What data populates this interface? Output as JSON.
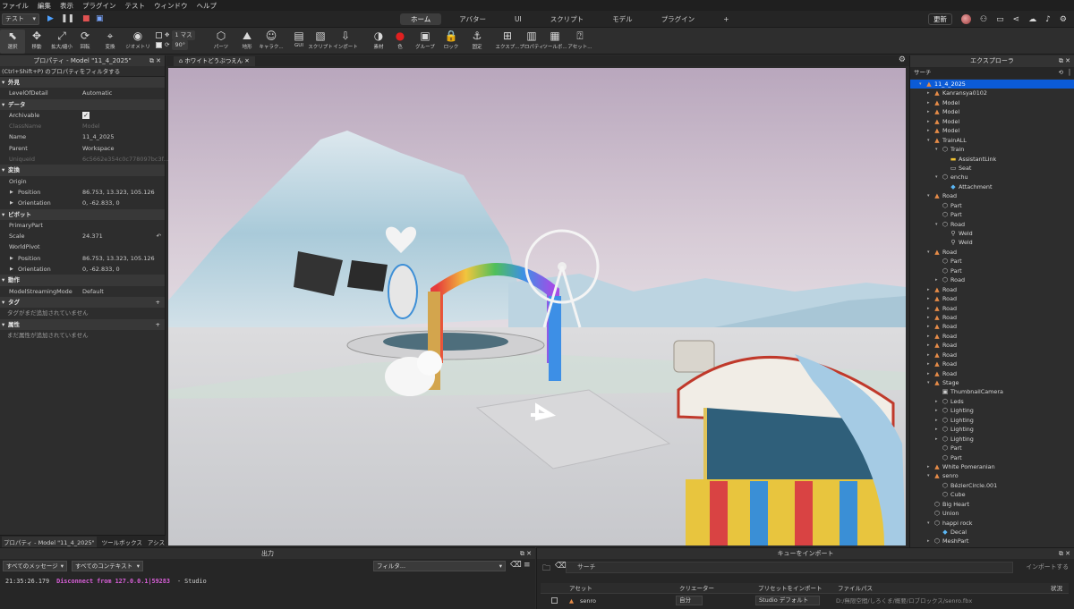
{
  "menu": [
    "ファイル",
    "編集",
    "表示",
    "プラグイン",
    "テスト",
    "ウィンドウ",
    "ヘルプ"
  ],
  "toolbar": {
    "mode_select": "テスト",
    "tabs": [
      "ホーム",
      "アバター",
      "UI",
      "スクリプト",
      "モデル",
      "プラグイン",
      "+"
    ],
    "active_tab": "ホーム",
    "update_label": "更新"
  },
  "ribbon": {
    "tools": [
      "選択",
      "移動",
      "拡大/縮小",
      "回転",
      "変換",
      "ジオメトリ",
      "パーツ",
      "地形",
      "キャラク...",
      "GUI",
      "スクリプト",
      "インポート",
      "素材",
      "色",
      "グループ",
      "ロック",
      "固定",
      "エクスプ...",
      "プロパティ",
      "ツールボ...",
      "アセット..."
    ],
    "grid_move": "1 マス",
    "grid_rotate": "90°"
  },
  "properties": {
    "title": "プロパティ - Model \"11_4_2025\"",
    "filter": "(Ctrl+Shift+P) のプロパティをフィルタする",
    "rows": [
      {
        "type": "section",
        "label": "外見"
      },
      {
        "type": "prop",
        "key": "LevelOfDetail",
        "value": "Automatic"
      },
      {
        "type": "section",
        "label": "データ"
      },
      {
        "type": "check",
        "key": "Archivable",
        "value": "✓"
      },
      {
        "type": "dim",
        "key": "ClassName",
        "value": "Model"
      },
      {
        "type": "prop",
        "key": "Name",
        "value": "11_4_2025"
      },
      {
        "type": "prop",
        "key": "Parent",
        "value": "Workspace"
      },
      {
        "type": "dim",
        "key": "UniqueId",
        "value": "6c5662e354c0c778097bc3f..."
      },
      {
        "type": "section",
        "label": "変換"
      },
      {
        "type": "prop",
        "key": "Origin",
        "value": ""
      },
      {
        "type": "sub",
        "key": "Position",
        "value": "86.753, 13.323, 105.126"
      },
      {
        "type": "sub",
        "key": "Orientation",
        "value": "0, -62.833, 0"
      },
      {
        "type": "section",
        "label": "ピボット"
      },
      {
        "type": "prop",
        "key": "PrimaryPart",
        "value": ""
      },
      {
        "type": "prop",
        "key": "Scale",
        "value": "24.371"
      },
      {
        "type": "prop",
        "key": "WorldPivot",
        "value": ""
      },
      {
        "type": "sub",
        "key": "Position",
        "value": "86.753, 13.323, 105.126"
      },
      {
        "type": "sub",
        "key": "Orientation",
        "value": "0, -62.833, 0"
      },
      {
        "type": "section",
        "label": "動作"
      },
      {
        "type": "prop",
        "key": "ModelStreamingMode",
        "value": "Default"
      },
      {
        "type": "section",
        "label": "タグ",
        "plus": "+"
      },
      {
        "type": "note",
        "key": "タグがまだ追加されていません"
      },
      {
        "type": "section",
        "label": "属性",
        "plus": "+"
      },
      {
        "type": "note",
        "key": "まだ属性が追加されていません"
      }
    ],
    "footer_tabs": [
      "プロパティ - Model \"11_4_2025\"",
      "ツールボックス",
      "アシス"
    ]
  },
  "viewport": {
    "doc_tab": "ホワイトどうぶつえん"
  },
  "explorer": {
    "title": "エクスプローラ",
    "search_placeholder": "サーチ",
    "items": [
      {
        "depth": 0,
        "arrow": "▾",
        "icon": "model",
        "label": "11_4_2025",
        "selected": true
      },
      {
        "depth": 1,
        "arrow": "▸",
        "icon": "model",
        "label": "Kanransya0102"
      },
      {
        "depth": 1,
        "arrow": "▸",
        "icon": "model",
        "label": "Model"
      },
      {
        "depth": 1,
        "arrow": "▸",
        "icon": "model",
        "label": "Model"
      },
      {
        "depth": 1,
        "arrow": "▸",
        "icon": "model",
        "label": "Model"
      },
      {
        "depth": 1,
        "arrow": "▸",
        "icon": "model",
        "label": "Model"
      },
      {
        "depth": 1,
        "arrow": "▾",
        "icon": "model",
        "label": "TrainALL"
      },
      {
        "depth": 2,
        "arrow": "▾",
        "icon": "part",
        "label": "Train"
      },
      {
        "depth": 3,
        "arrow": "",
        "icon": "folder",
        "label": "AssistantLink"
      },
      {
        "depth": 3,
        "arrow": "",
        "icon": "seat",
        "label": "Seat"
      },
      {
        "depth": 2,
        "arrow": "▾",
        "icon": "part",
        "label": "enchu"
      },
      {
        "depth": 3,
        "arrow": "",
        "icon": "attachment",
        "label": "Attachment"
      },
      {
        "depth": 1,
        "arrow": "▾",
        "icon": "model",
        "label": "Road"
      },
      {
        "depth": 2,
        "arrow": "",
        "icon": "part",
        "label": "Part"
      },
      {
        "depth": 2,
        "arrow": "",
        "icon": "part",
        "label": "Part"
      },
      {
        "depth": 2,
        "arrow": "▾",
        "icon": "part",
        "label": "Road"
      },
      {
        "depth": 3,
        "arrow": "",
        "icon": "weld",
        "label": "Weld"
      },
      {
        "depth": 3,
        "arrow": "",
        "icon": "weld",
        "label": "Weld"
      },
      {
        "depth": 1,
        "arrow": "▾",
        "icon": "model",
        "label": "Road"
      },
      {
        "depth": 2,
        "arrow": "",
        "icon": "part",
        "label": "Part"
      },
      {
        "depth": 2,
        "arrow": "",
        "icon": "part",
        "label": "Part"
      },
      {
        "depth": 2,
        "arrow": "▸",
        "icon": "part",
        "label": "Road"
      },
      {
        "depth": 1,
        "arrow": "▸",
        "icon": "model",
        "label": "Road"
      },
      {
        "depth": 1,
        "arrow": "▸",
        "icon": "model",
        "label": "Road"
      },
      {
        "depth": 1,
        "arrow": "▸",
        "icon": "model",
        "label": "Road"
      },
      {
        "depth": 1,
        "arrow": "▸",
        "icon": "model",
        "label": "Road"
      },
      {
        "depth": 1,
        "arrow": "▸",
        "icon": "model",
        "label": "Road"
      },
      {
        "depth": 1,
        "arrow": "▸",
        "icon": "model",
        "label": "Road"
      },
      {
        "depth": 1,
        "arrow": "▸",
        "icon": "model",
        "label": "Road"
      },
      {
        "depth": 1,
        "arrow": "▸",
        "icon": "model",
        "label": "Road"
      },
      {
        "depth": 1,
        "arrow": "▸",
        "icon": "model",
        "label": "Road"
      },
      {
        "depth": 1,
        "arrow": "▸",
        "icon": "model",
        "label": "Road"
      },
      {
        "depth": 1,
        "arrow": "▾",
        "icon": "model",
        "label": "Stage"
      },
      {
        "depth": 2,
        "arrow": "",
        "icon": "camera",
        "label": "ThumbnailCamera"
      },
      {
        "depth": 2,
        "arrow": "▸",
        "icon": "part",
        "label": "Leds"
      },
      {
        "depth": 2,
        "arrow": "▸",
        "icon": "part",
        "label": "Lighting"
      },
      {
        "depth": 2,
        "arrow": "▸",
        "icon": "part",
        "label": "Lighting"
      },
      {
        "depth": 2,
        "arrow": "▸",
        "icon": "part",
        "label": "Lighting"
      },
      {
        "depth": 2,
        "arrow": "▸",
        "icon": "part",
        "label": "Lighting"
      },
      {
        "depth": 2,
        "arrow": "",
        "icon": "part",
        "label": "Part"
      },
      {
        "depth": 2,
        "arrow": "",
        "icon": "part",
        "label": "Part"
      },
      {
        "depth": 1,
        "arrow": "▸",
        "icon": "model",
        "label": "White Pomeranian"
      },
      {
        "depth": 1,
        "arrow": "▾",
        "icon": "model",
        "label": "senro"
      },
      {
        "depth": 2,
        "arrow": "",
        "icon": "part",
        "label": "BézierCircle.001"
      },
      {
        "depth": 2,
        "arrow": "",
        "icon": "part",
        "label": "Cube"
      },
      {
        "depth": 1,
        "arrow": "",
        "icon": "part",
        "label": "Big Heart"
      },
      {
        "depth": 1,
        "arrow": "",
        "icon": "part",
        "label": "Union"
      },
      {
        "depth": 1,
        "arrow": "▾",
        "icon": "part",
        "label": "happi rock"
      },
      {
        "depth": 2,
        "arrow": "",
        "icon": "attachment",
        "label": "Decal"
      },
      {
        "depth": 1,
        "arrow": "▸",
        "icon": "part",
        "label": "MeshPart"
      }
    ]
  },
  "output": {
    "title": "出力",
    "messages_filter": "すべてのメッセージ",
    "context_filter": "すべてのコンテキスト",
    "search_placeholder": "フィルタ...",
    "line_time": "21:35:26.179",
    "line_text": "Disconnect from 127.0.0.1|59283",
    "line_source": "-  Studio"
  },
  "import_queue": {
    "title": "キューをインポート",
    "search_placeholder": "サーチ",
    "import_button": "インポートする",
    "columns": [
      "アセット",
      "クリエーター",
      "プリセットをインポート",
      "ファイルパス",
      "状況"
    ],
    "row": {
      "asset": "senro",
      "creator": "自分",
      "preset": "Studio デフォルト",
      "path": "D:/無限空間/しろくま/概要/ロブロックス/senro.fbx"
    }
  }
}
